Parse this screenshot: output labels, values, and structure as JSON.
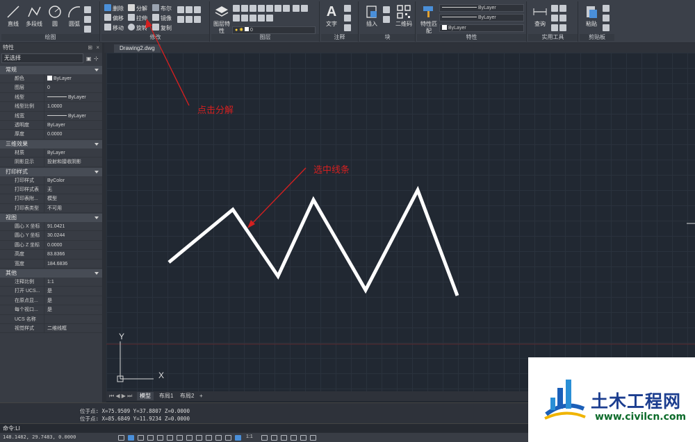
{
  "ribbon": {
    "draw": {
      "title": "绘图",
      "line": "直线",
      "polyline": "多段线",
      "circle": "圆",
      "arc": "圆弧"
    },
    "modify": {
      "title": "修改",
      "erase": "删除",
      "explode": "分解",
      "boolean": "布尔",
      "offset": "偏移",
      "stretch": "拉伸",
      "mirror": "镜像",
      "move": "移动",
      "rotate": "旋转",
      "copy": "复制"
    },
    "layer": {
      "title": "图层",
      "layer_props": "图层特性",
      "current_layer": "0"
    },
    "annotation": {
      "title": "注释",
      "text": "文字"
    },
    "block": {
      "title": "块",
      "insert": "插入",
      "qrcode": "二维码"
    },
    "properties": {
      "title": "特性",
      "match": "特性匹配",
      "color": "ByLayer",
      "linetype": "ByLayer",
      "lineweight": "ByLayer"
    },
    "utilities": {
      "title": "实用工具",
      "query": "查询"
    },
    "clipboard": {
      "title": "剪贴板",
      "paste": "粘贴"
    }
  },
  "props_panel": {
    "title": "特性",
    "selection": "无选择",
    "sections": [
      {
        "name": "常规",
        "rows": [
          {
            "key": "颜色",
            "value": "ByLayer"
          },
          {
            "key": "图层",
            "value": "0"
          },
          {
            "key": "线型",
            "value": "ByLayer"
          },
          {
            "key": "线型比例",
            "value": "1.0000"
          },
          {
            "key": "线宽",
            "value": "ByLayer"
          },
          {
            "key": "透明度",
            "value": "ByLayer"
          },
          {
            "key": "厚度",
            "value": "0.0000"
          }
        ]
      },
      {
        "name": "三维效果",
        "rows": [
          {
            "key": "材质",
            "value": "ByLayer"
          },
          {
            "key": "阴影显示",
            "value": "投射和接收阴影"
          }
        ]
      },
      {
        "name": "打印样式",
        "rows": [
          {
            "key": "打印样式",
            "value": "ByColor"
          },
          {
            "key": "打印样式表",
            "value": "无"
          },
          {
            "key": "打印表附...",
            "value": "模型"
          },
          {
            "key": "打印表类型",
            "value": "不可用"
          }
        ]
      },
      {
        "name": "视图",
        "rows": [
          {
            "key": "圆心 X 坐标",
            "value": "91.0421"
          },
          {
            "key": "圆心 Y 坐标",
            "value": "30.0244"
          },
          {
            "key": "圆心 Z 坐标",
            "value": "0.0000"
          },
          {
            "key": "高度",
            "value": "83.8366"
          },
          {
            "key": "宽度",
            "value": "184.6836"
          }
        ]
      },
      {
        "name": "其他",
        "rows": [
          {
            "key": "注释比例",
            "value": "1:1"
          },
          {
            "key": "打开 UCS...",
            "value": "是"
          },
          {
            "key": "在原点显...",
            "value": "是"
          },
          {
            "key": "每个视口...",
            "value": "是"
          },
          {
            "key": "UCS 名称",
            "value": ""
          },
          {
            "key": "视觉样式",
            "value": "二维线框"
          }
        ]
      }
    ]
  },
  "document": {
    "tab": "Drawing2.dwg"
  },
  "layout_tabs": {
    "model": "模型",
    "layout1": "布局1",
    "layout2": "布局2",
    "add": "+"
  },
  "annotations": {
    "explode_hint": "点击分解",
    "select_hint": "选中线条"
  },
  "ucs": {
    "x": "X",
    "y": "Y"
  },
  "command": {
    "history1": "位于点: X=75.9509  Y=37.8807  Z=0.0000",
    "history2": "位于点: X=85.6849  Y=11.9234  Z=0.0000",
    "prompt": "命令:LI"
  },
  "status": {
    "coords": "148.1482, 29.7483, 0.0000",
    "scale": "1:1"
  },
  "watermark": {
    "name": "土木工程网",
    "url": "www.civilcn.com"
  },
  "colors": {
    "accent_red": "#d42020",
    "canvas_bg": "#212832",
    "polyline": "#ffffff"
  }
}
